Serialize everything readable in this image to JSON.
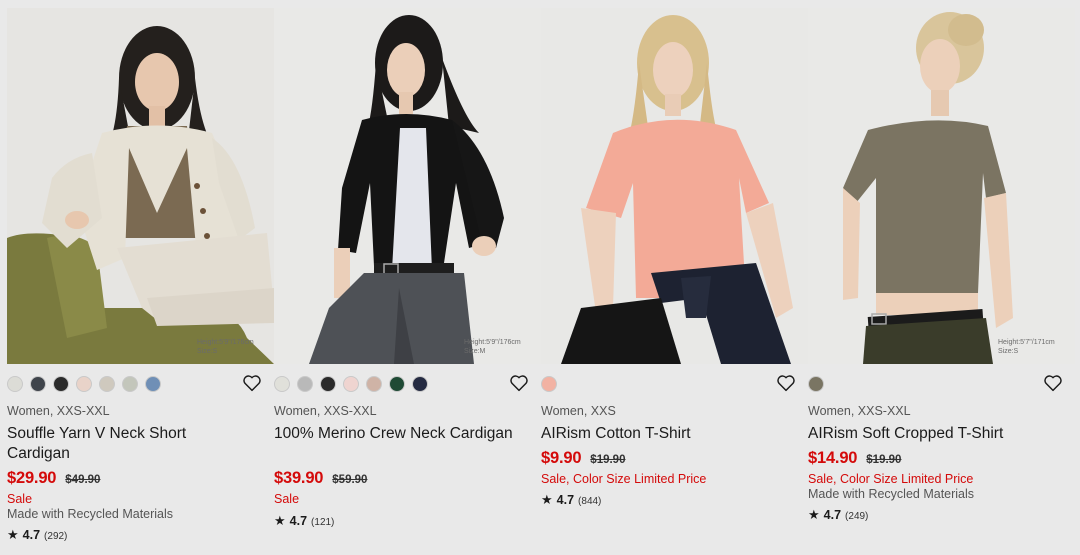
{
  "products": [
    {
      "size_note": "Height:5'9\"/176cm\nSize:S",
      "swatches": [
        "#dcdcd6",
        "#3f444b",
        "#2b2b2b",
        "#e9d3c9",
        "#cfc9be",
        "#c3c6bb",
        "#6f8fb6"
      ],
      "gender_sizes": "Women, XXS-XXL",
      "name": "Souffle Yarn V Neck Short Cardigan",
      "price": "$29.90",
      "original_price": "$49.90",
      "sale_label": "Sale",
      "recycled": "Made with Recycled Materials",
      "rating": "4.7",
      "review_count": "(292)"
    },
    {
      "size_note": "Height:5'9\"/176cm\nSize:M",
      "swatches": [
        "#e0e0da",
        "#b9b9b9",
        "#2a2a2a",
        "#efd4d0",
        "#cfb3a6",
        "#1f4a35",
        "#252b42"
      ],
      "gender_sizes": "Women, XXS-XXL",
      "name": "100% Merino Crew Neck Cardigan",
      "price": "$39.90",
      "original_price": "$59.90",
      "sale_label": "Sale",
      "recycled": "",
      "rating": "4.7",
      "review_count": "(121)"
    },
    {
      "size_note": "",
      "swatches": [
        "#f2b2a3"
      ],
      "gender_sizes": "Women, XXS",
      "name": "AIRism Cotton T-Shirt",
      "price": "$9.90",
      "original_price": "$19.90",
      "sale_label": "Sale, Color Size Limited Price",
      "recycled": "",
      "rating": "4.7",
      "review_count": "(844)"
    },
    {
      "size_note": "Height:5'7\"/171cm\nSize:S",
      "swatches": [
        "#7a7563"
      ],
      "gender_sizes": "Women, XXS-XXL",
      "name": "AIRism Soft Cropped T-Shirt",
      "price": "$14.90",
      "original_price": "$19.90",
      "sale_label": "Sale, Color Size Limited Price",
      "recycled": "Made with Recycled Materials",
      "rating": "4.7",
      "review_count": "(249)"
    }
  ],
  "colors": {
    "sale_red": "#d40a0a",
    "page_background": "#e9e9e9"
  },
  "icons": {
    "favorite": "heart-outline-icon",
    "rating": "star-icon"
  }
}
